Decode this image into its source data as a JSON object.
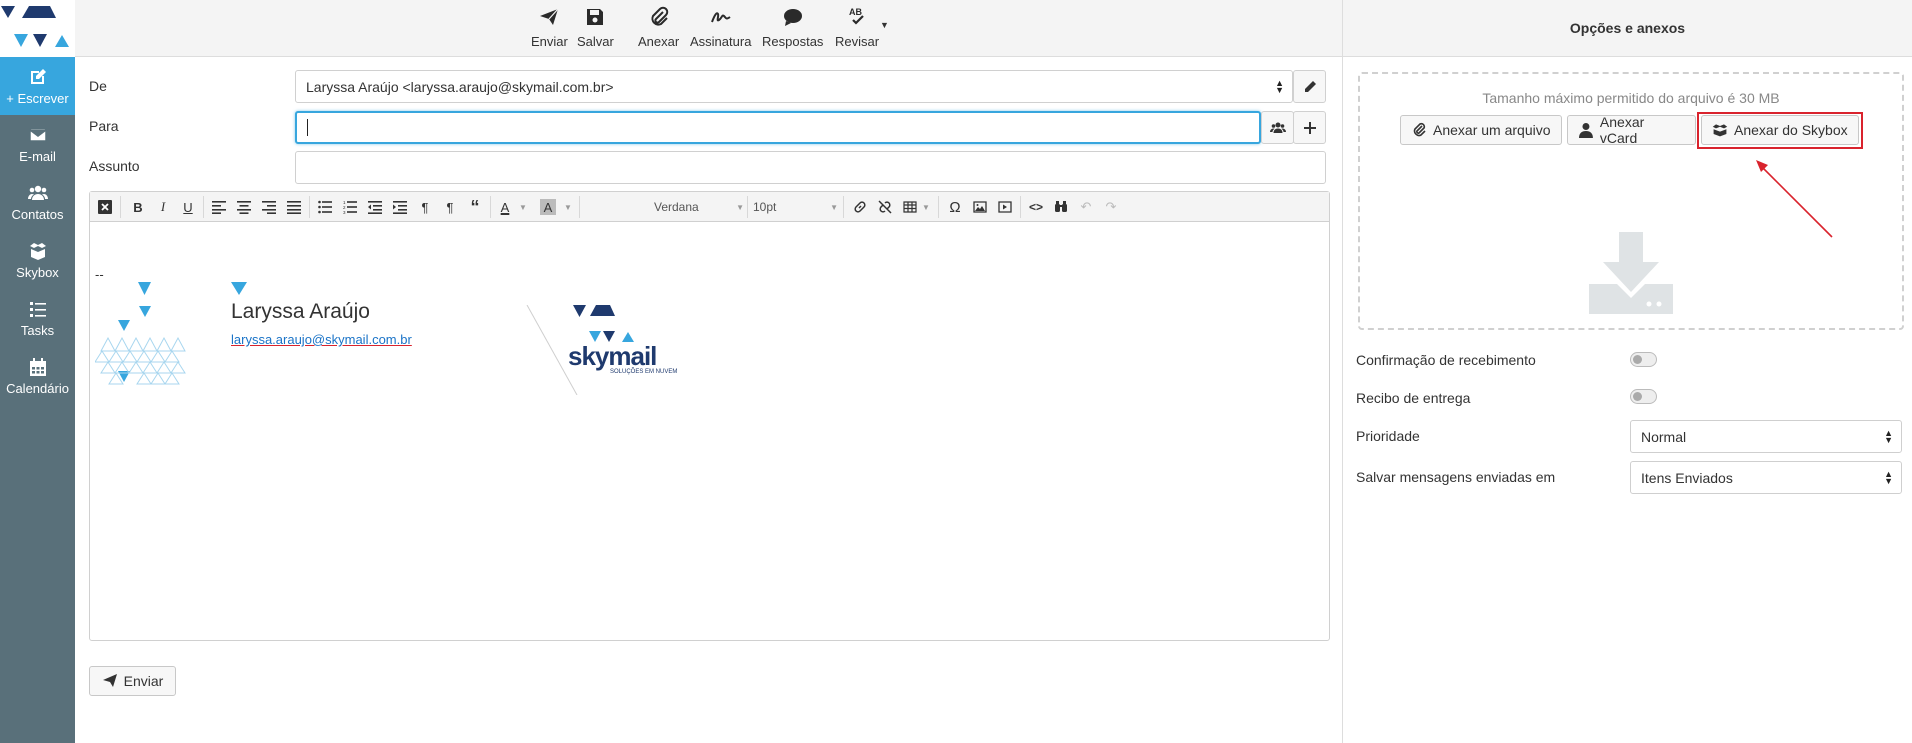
{
  "sidebar": {
    "items": [
      {
        "label": "+ Escrever",
        "icon": "compose-icon",
        "active": true
      },
      {
        "label": "E-mail",
        "icon": "mail-icon"
      },
      {
        "label": "Contatos",
        "icon": "contacts-icon"
      },
      {
        "label": "Skybox",
        "icon": "skybox-icon"
      },
      {
        "label": "Tasks",
        "icon": "tasks-icon"
      },
      {
        "label": "Calendário",
        "icon": "calendar-icon"
      }
    ]
  },
  "toolbar": {
    "send": "Enviar",
    "save": "Salvar",
    "attach": "Anexar",
    "signature": "Assinatura",
    "responses": "Respostas",
    "review": "Revisar"
  },
  "form": {
    "from_label": "De",
    "from_value": "Laryssa Araújo <laryssa.araujo@skymail.com.br>",
    "to_label": "Para",
    "to_value": "",
    "subject_label": "Assunto",
    "subject_value": ""
  },
  "editor": {
    "font": "Verdana",
    "size": "10pt"
  },
  "signature": {
    "dash": "--",
    "name": "Laryssa Araújo",
    "email": "laryssa.araujo@skymail.com.br",
    "brand": "skymail",
    "tagline": "SOLUÇÕES EM NUVEM"
  },
  "send_button": "Enviar",
  "panel": {
    "title": "Opções e anexos",
    "max_size": "Tamanho máximo permitido do arquivo é 30 MB",
    "attach_file": "Anexar um arquivo",
    "attach_vcard": "Anexar vCard",
    "attach_skybox": "Anexar do Skybox",
    "read_receipt": "Confirmação de recebimento",
    "delivery_receipt": "Recibo de entrega",
    "priority_label": "Prioridade",
    "priority_value": "Normal",
    "save_sent_label": "Salvar mensagens enviadas em",
    "save_sent_value": "Itens Enviados"
  },
  "colors": {
    "accent": "#37a6de",
    "sidebar": "#59707a",
    "highlight": "#d9232d",
    "brand_dark": "#1f3a6e"
  }
}
